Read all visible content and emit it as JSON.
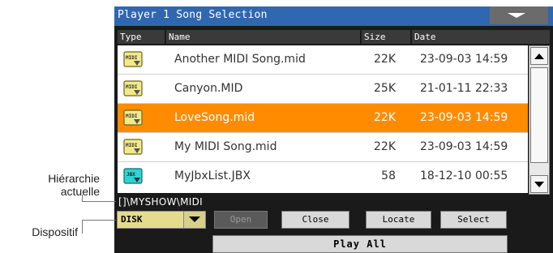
{
  "title": "Player 1 Song Selection",
  "columns": {
    "type": "Type",
    "name": "Name",
    "size": "Size",
    "date": "Date"
  },
  "files": [
    {
      "icon": "midi-file-icon",
      "name": "Another MIDI Song.mid",
      "size": "22K",
      "date": "23-09-03 14:59",
      "selected": false
    },
    {
      "icon": "midi-file-icon",
      "name": "Canyon.MID",
      "size": "25K",
      "date": "21-01-11 22:33",
      "selected": false
    },
    {
      "icon": "midi-file-icon",
      "name": "LoveSong.mid",
      "size": "22K",
      "date": "23-09-03 14:59",
      "selected": true
    },
    {
      "icon": "midi-file-icon",
      "name": "My MIDI Song.mid",
      "size": "22K",
      "date": "23-09-03 14:59",
      "selected": false
    },
    {
      "icon": "jbx-file-icon",
      "name": "MyJbxList.JBX",
      "size": "58",
      "date": "18-12-10 00:55",
      "selected": false
    }
  ],
  "path": "[]\\MYSHOW\\MIDI",
  "device": {
    "value": "DISK"
  },
  "buttons": {
    "open": "Open",
    "close": "Close",
    "locate": "Locate",
    "select": "Select",
    "play_all": "Play All"
  },
  "callouts": {
    "hierarchy_line1": "Hiérarchie",
    "hierarchy_line2": "actuelle",
    "device": "Dispositif"
  },
  "colors": {
    "title_bar": "#2f67b1",
    "selected_row": "#ff8c00",
    "device_select": "#e4dc8c",
    "midi_icon": "#f3e98a",
    "jbx_icon": "#2ed3d3"
  }
}
